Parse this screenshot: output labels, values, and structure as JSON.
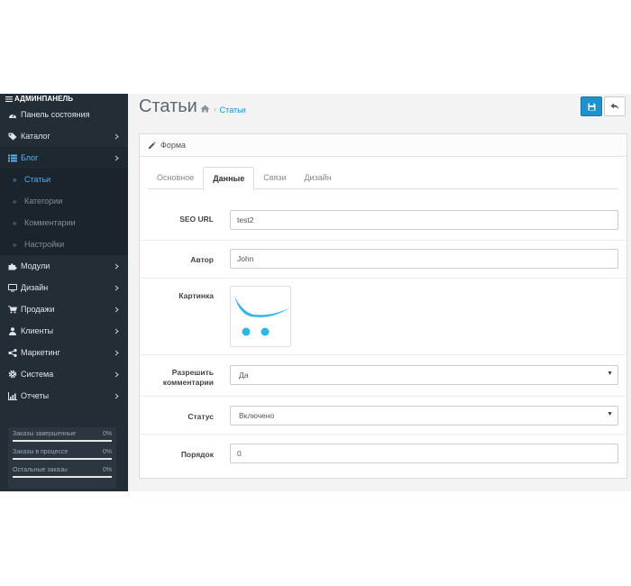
{
  "sidebar": {
    "header": "АДМИНПАНЕЛЬ",
    "items": [
      {
        "label": "Панель состояния",
        "icon": "dashboard-icon",
        "has_children": false
      },
      {
        "label": "Каталог",
        "icon": "tag-icon",
        "has_children": true
      },
      {
        "label": "Блог",
        "icon": "list-icon",
        "has_children": true,
        "expanded": true
      },
      {
        "label": "Модули",
        "icon": "puzzle-icon",
        "has_children": true
      },
      {
        "label": "Дизайн",
        "icon": "desktop-icon",
        "has_children": true
      },
      {
        "label": "Продажи",
        "icon": "cart-icon",
        "has_children": true
      },
      {
        "label": "Клиенты",
        "icon": "user-icon",
        "has_children": true
      },
      {
        "label": "Маркетинг",
        "icon": "share-icon",
        "has_children": true
      },
      {
        "label": "Система",
        "icon": "gear-icon",
        "has_children": true
      },
      {
        "label": "Отчеты",
        "icon": "chart-icon",
        "has_children": true
      }
    ],
    "blog_sub": [
      {
        "label": "Статьи",
        "current": true
      },
      {
        "label": "Категории"
      },
      {
        "label": "Комментарии"
      },
      {
        "label": "Настройки"
      }
    ],
    "stats": [
      {
        "label": "Заказы завершенные",
        "value": "0%",
        "progress": 0
      },
      {
        "label": "Заказы в процессе",
        "value": "0%",
        "progress": 0
      },
      {
        "label": "Остальные заказы",
        "value": "0%",
        "progress": 0
      }
    ]
  },
  "header": {
    "title": "Статьи",
    "breadcrumb": [
      "Статьи"
    ]
  },
  "panel": {
    "title": "Форма",
    "tabs": [
      {
        "label": "Основное"
      },
      {
        "label": "Данные",
        "active": true
      },
      {
        "label": "Связи"
      },
      {
        "label": "Дизайн"
      }
    ],
    "fields": {
      "seo_url": {
        "label": "SEO URL",
        "value": "test2"
      },
      "author": {
        "label": "Автор",
        "value": "John"
      },
      "image": {
        "label": "Картинка"
      },
      "allow_comments": {
        "label_line1": "Разрешить",
        "label_line2": "комментарии",
        "value": "Да"
      },
      "status": {
        "label": "Статус",
        "value": "Включено"
      },
      "sort_order": {
        "label": "Порядок",
        "value": "0"
      }
    }
  },
  "colors": {
    "sidebar_bg": "#222d36",
    "accent": "#1e91cf",
    "link": "#4fb0f3"
  }
}
